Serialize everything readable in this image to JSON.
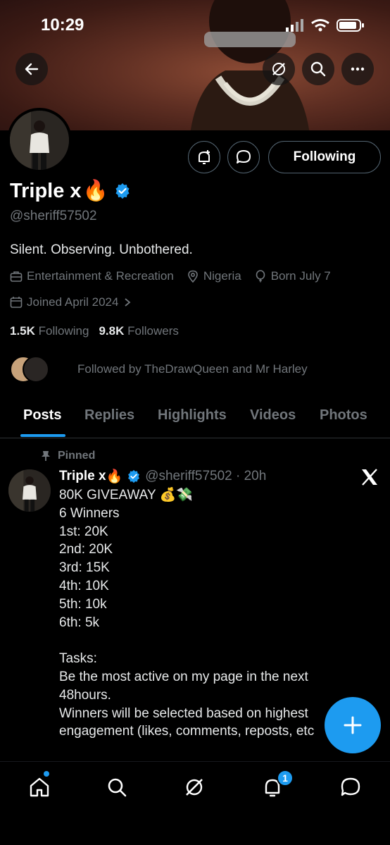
{
  "status_bar": {
    "time": "10:29"
  },
  "profile": {
    "name": "Triple x",
    "name_emoji": "🔥",
    "handle": "@sheriff57502",
    "bio": "Silent. Observing. Unbothered.",
    "category": "Entertainment & Recreation",
    "location": "Nigeria",
    "birthday": "Born July 7",
    "joined": "Joined April 2024",
    "following_count": "1.5K",
    "following_label": "Following",
    "followers_count": "9.8K",
    "followers_label": "Followers",
    "followed_by": "Followed by TheDrawQueen and Mr Harley",
    "follow_button": "Following"
  },
  "tabs": [
    {
      "label": "Posts",
      "active": true
    },
    {
      "label": "Replies"
    },
    {
      "label": "Highlights"
    },
    {
      "label": "Videos"
    },
    {
      "label": "Photos"
    }
  ],
  "post": {
    "pinned_label": "Pinned",
    "author": "Triple x",
    "author_emoji": "🔥",
    "handle_time": "@sheriff57502 · 20h",
    "lines": [
      "80K GIVEAWAY 💰💸",
      "6 Winners",
      "1st: 20K",
      "2nd: 20K",
      "3rd: 15K",
      "4th: 10K",
      "5th: 10k",
      "6th: 5k",
      "",
      "Tasks:",
      "Be the most active on my page in the next",
      "48hours.",
      "Winners will be selected based on highest",
      "engagement (likes, comments, reposts, etc"
    ]
  },
  "notifications_badge": "1",
  "colors": {
    "accent": "#1d9bf0",
    "muted": "#71767b",
    "background": "#000000"
  }
}
